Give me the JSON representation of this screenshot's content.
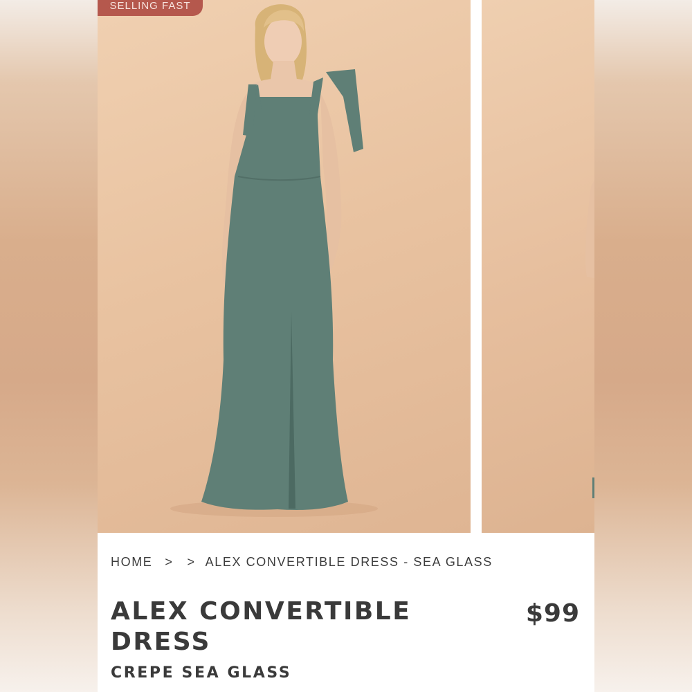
{
  "badge": {
    "label": "SELLING FAST"
  },
  "gallery": {
    "main_image": "model-in-sea-glass-gown",
    "next_image": "next-gallery-image"
  },
  "breadcrumb": {
    "home": "HOME",
    "separator": ">",
    "current": "ALEX CONVERTIBLE DRESS - SEA GLASS"
  },
  "product": {
    "title": "ALEX CONVERTIBLE DRESS",
    "price": "$99",
    "subtitle": "CREPE SEA GLASS"
  },
  "colors": {
    "badge": "#b5584d",
    "dress": "#5f7f76",
    "backdrop": "#e9c3a1",
    "text": "#3a3a3a"
  }
}
